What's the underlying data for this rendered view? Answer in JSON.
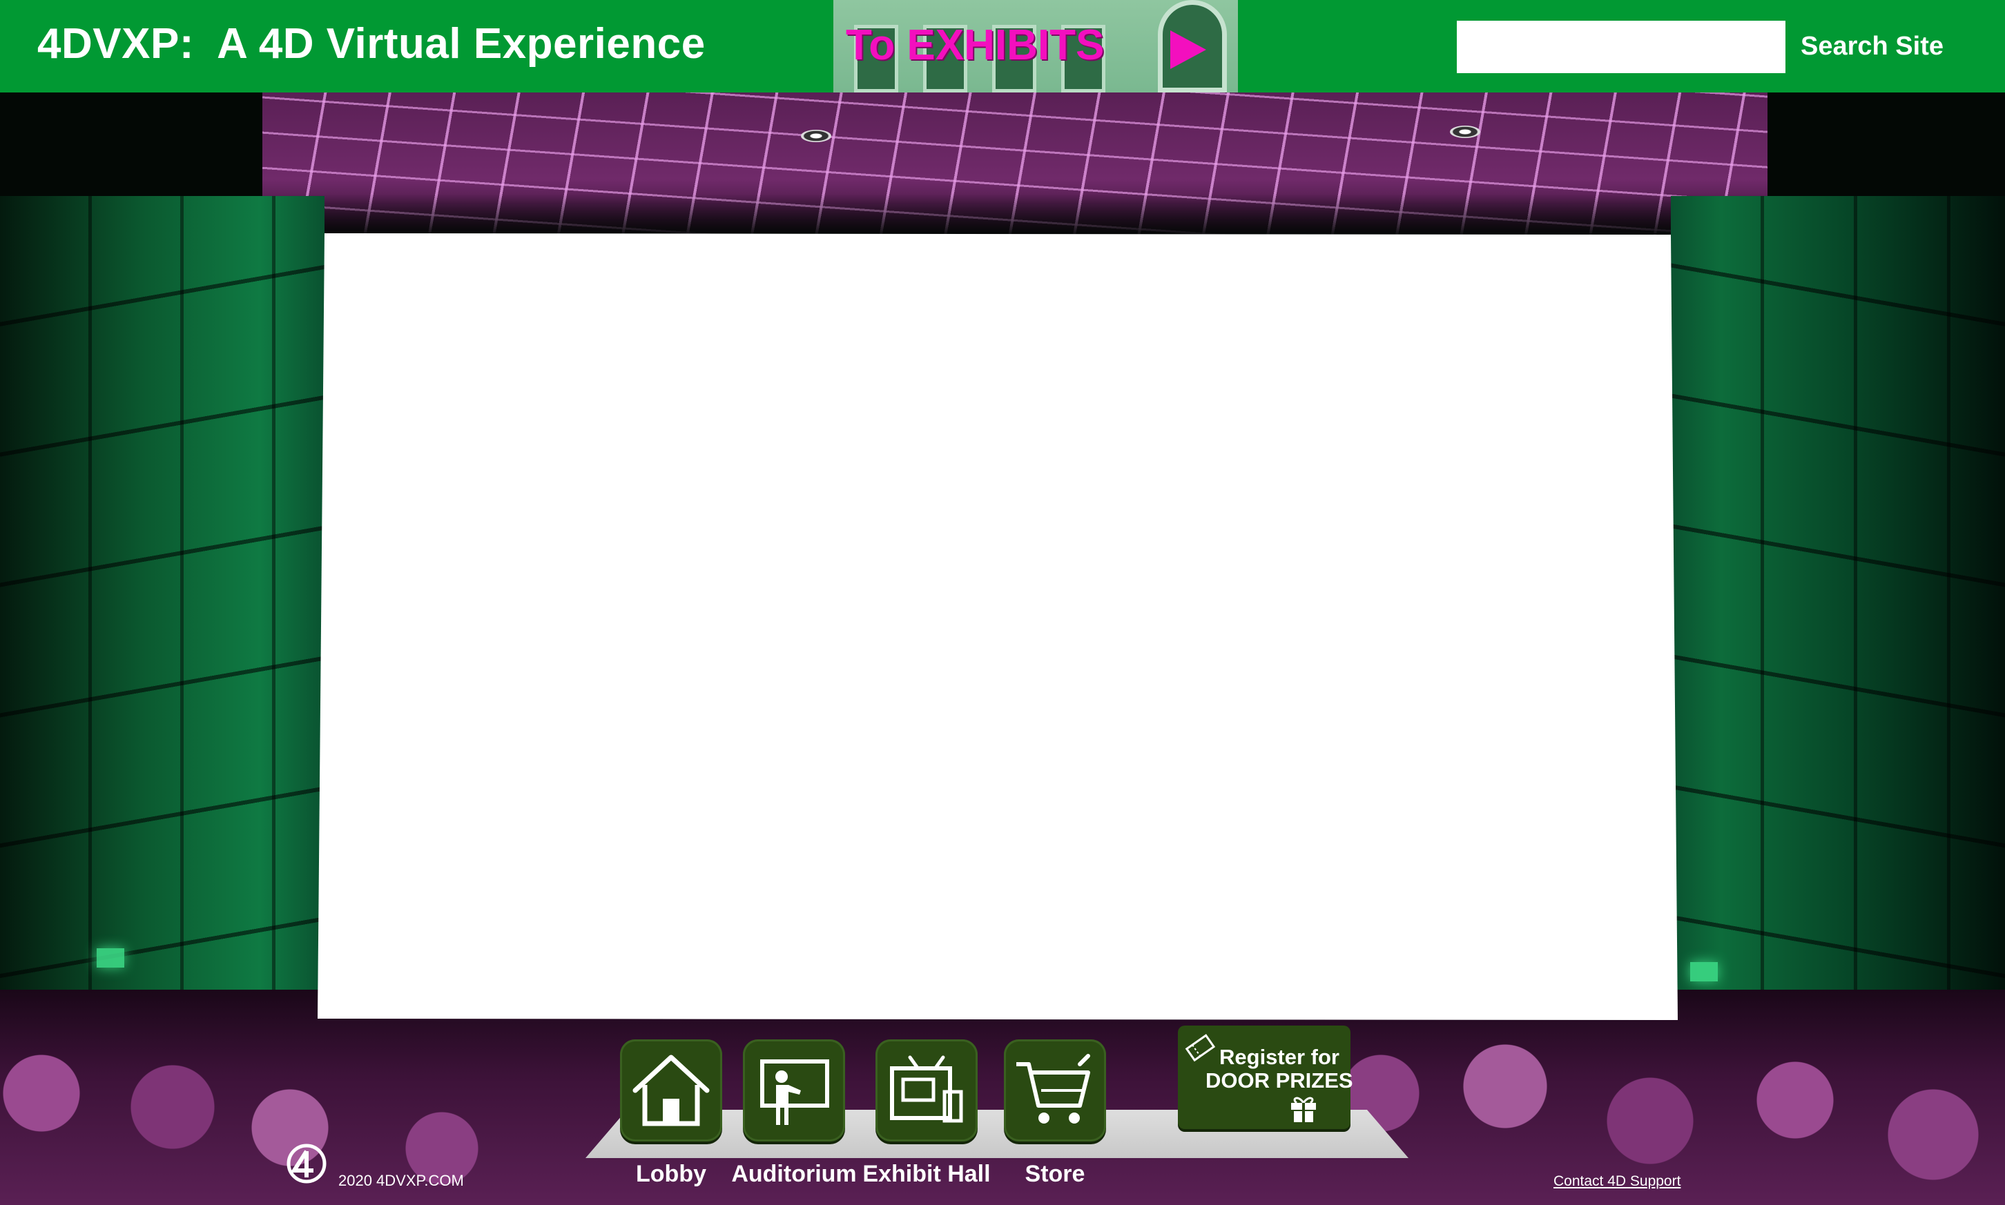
{
  "header": {
    "title": "4DVXP:  A 4D Virtual Experience",
    "exhibits_link": "To EXHIBITS",
    "search": {
      "placeholder": "",
      "button_label": "Search Site"
    }
  },
  "nav": {
    "items": [
      {
        "label": "Lobby",
        "icon": "house-icon"
      },
      {
        "label": "Auditorium",
        "icon": "presenter-icon"
      },
      {
        "label": "Exhibit Hall",
        "icon": "exhibit-booth-icon"
      },
      {
        "label": "Store",
        "icon": "shopping-cart-icon"
      }
    ],
    "door_prizes": {
      "line1": "Register for",
      "line2": "DOOR PRIZES"
    }
  },
  "footer": {
    "copyright": "2020 4DVXP.COM",
    "contact_link": "Contact 4D Support"
  },
  "colors": {
    "header_green": "#019933",
    "exhibits_magenta": "#f30fbe",
    "nav_button_green": "#2a4a12"
  }
}
